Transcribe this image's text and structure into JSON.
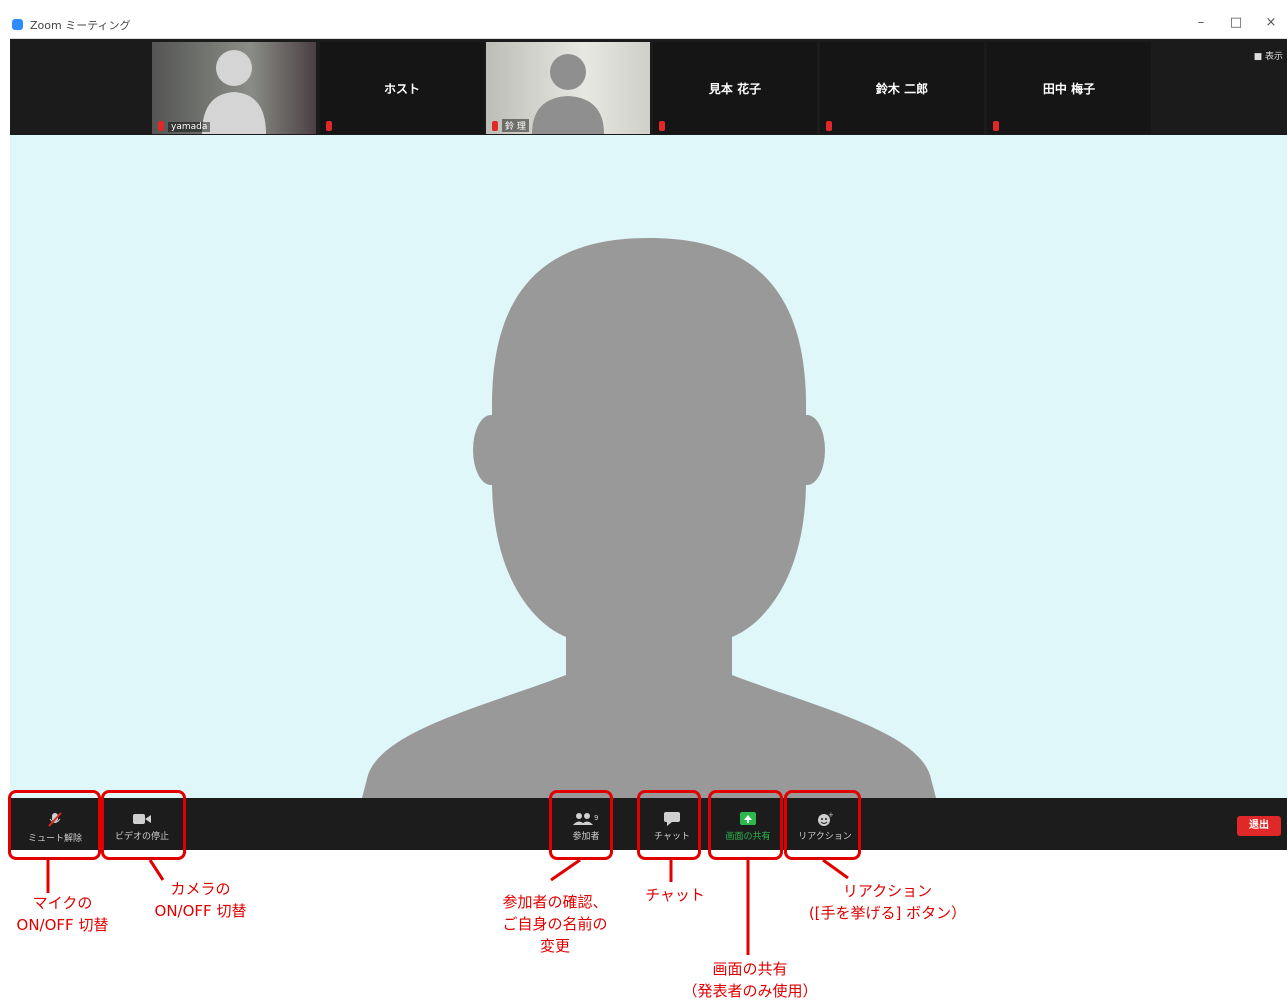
{
  "window": {
    "title": "Zoom ミーティング",
    "controls": {
      "minimize": "–",
      "maximize": "□",
      "close": "×"
    }
  },
  "strip": {
    "view_label": "■ 表示",
    "tiles": [
      {
        "name": "",
        "video_name": "yamada",
        "type": "video"
      },
      {
        "name": "ホスト",
        "video_name": "",
        "type": "name"
      },
      {
        "name": "",
        "video_name": "鈴 理",
        "type": "video"
      },
      {
        "name": "見本 花子",
        "video_name": "",
        "type": "name"
      },
      {
        "name": "鈴木 二郎",
        "video_name": "",
        "type": "name"
      },
      {
        "name": "田中 梅子",
        "video_name": "",
        "type": "name"
      }
    ]
  },
  "toolbar": {
    "mute": "ミュート解除",
    "video": "ビデオの停止",
    "participants": "参加者",
    "participants_count": "9",
    "chat": "チャット",
    "share": "画面の共有",
    "reactions": "リアクション",
    "leave": "退出"
  },
  "annotations": {
    "mic": "マイクの\nON/OFF 切替",
    "camera": "カメラの\nON/OFF 切替",
    "participants": "参加者の確認、\nご自身の名前の\n変更",
    "chat": "チャット",
    "share": "画面の共有\n（発表者のみ使用）",
    "reactions": "リアクション\n([手を挙げる] ボタン）"
  },
  "colors": {
    "annotation": "#e00000",
    "stage_bg": "#dff7f9",
    "silhouette": "#999999",
    "share_green": "#2db84d",
    "leave_red": "#e02828"
  }
}
